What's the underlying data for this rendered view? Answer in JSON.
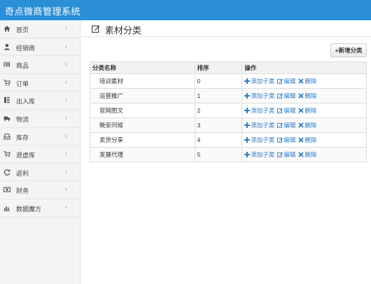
{
  "app": {
    "title": "奇点微商管理系统"
  },
  "sidebar": {
    "items": [
      {
        "label": "首页",
        "icon": "home-icon"
      },
      {
        "label": "经销商",
        "icon": "user-icon"
      },
      {
        "label": "商品",
        "icon": "barcode-icon"
      },
      {
        "label": "订单",
        "icon": "cart-icon"
      },
      {
        "label": "出入库",
        "icon": "doc-icon"
      },
      {
        "label": "物流",
        "icon": "truck-icon"
      },
      {
        "label": "库存",
        "icon": "inbox-icon"
      },
      {
        "label": "退虚库",
        "icon": "cart-icon"
      },
      {
        "label": "返利",
        "icon": "refresh-icon"
      },
      {
        "label": "财务",
        "icon": "money-icon"
      },
      {
        "label": "数据魔方",
        "icon": "chart-icon"
      }
    ],
    "chevron": "›"
  },
  "page": {
    "title": "素材分类"
  },
  "toolbar": {
    "add_label": "+新增分类"
  },
  "table": {
    "headers": [
      "分类名称",
      "排序",
      "操作"
    ],
    "rows": [
      {
        "name": "培训素材",
        "sort": "0"
      },
      {
        "name": "运营推广",
        "sort": "1"
      },
      {
        "name": "官网图文",
        "sort": "2"
      },
      {
        "name": "晚安问候",
        "sort": "3"
      },
      {
        "name": "卖货分享",
        "sort": "4"
      },
      {
        "name": "发展代理",
        "sort": "5"
      }
    ],
    "actions": {
      "add_child": "添加子类",
      "edit": "编辑",
      "delete": "删除"
    }
  },
  "colors": {
    "accent": "#2a8fd7",
    "link": "#2a7ac9"
  }
}
